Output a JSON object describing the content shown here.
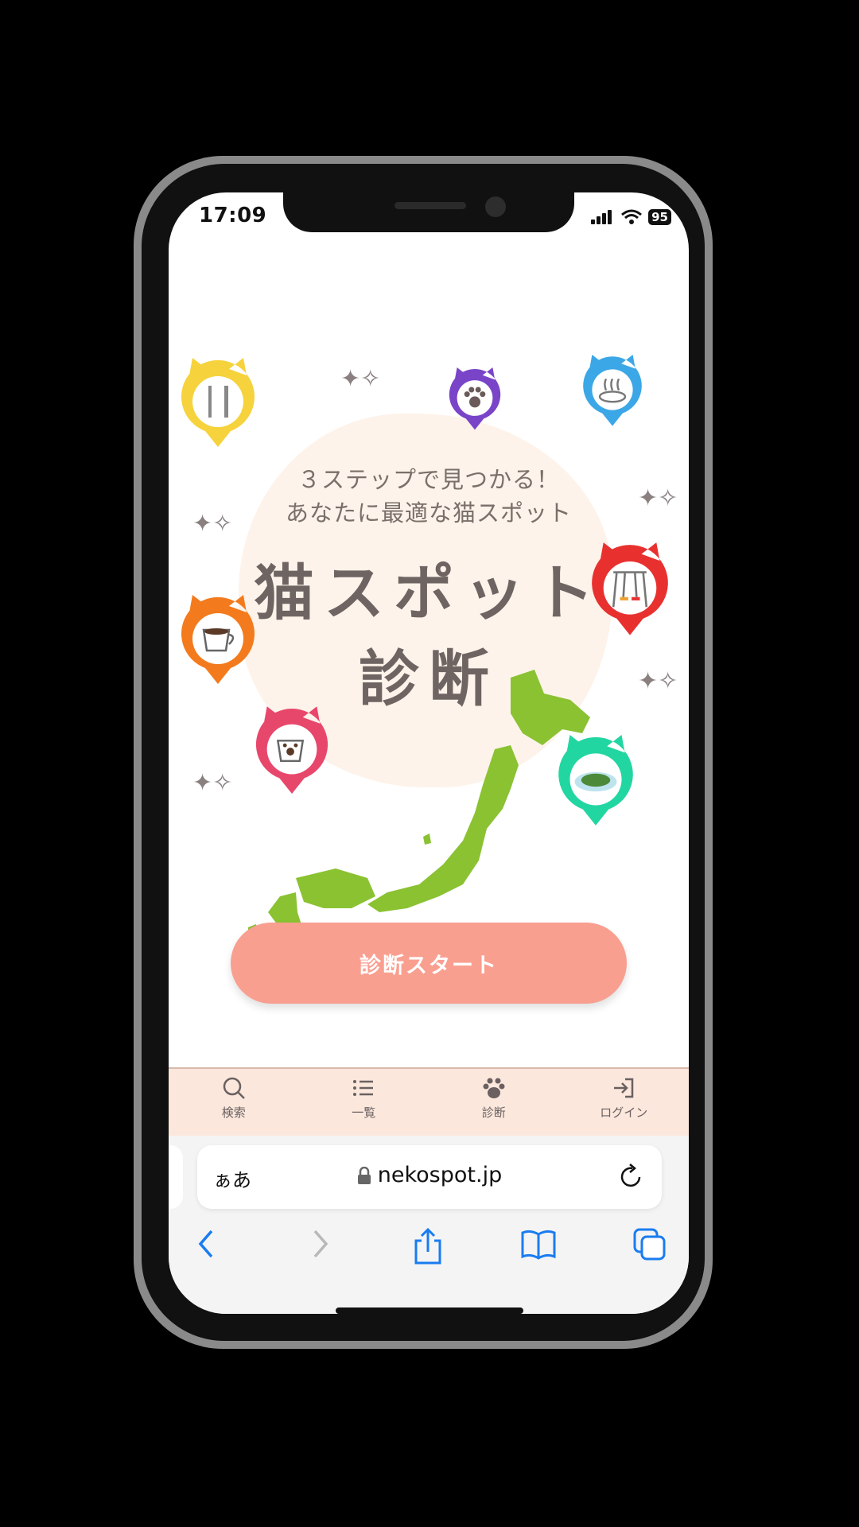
{
  "status_bar": {
    "time": "17:09",
    "battery": "95"
  },
  "hero": {
    "tagline_line1": "３ステップで見つかる！",
    "tagline_line2": "あなたに最適な猫スポット",
    "title_line1": "猫スポット",
    "title_line2": "診断",
    "pins": [
      {
        "name": "restaurant-pin-icon",
        "color": "#f6d23c"
      },
      {
        "name": "paw-pin-icon",
        "color": "#7a44c8"
      },
      {
        "name": "onsen-pin-icon",
        "color": "#3ba7e6"
      },
      {
        "name": "playground-pin-icon",
        "color": "#e8312f"
      },
      {
        "name": "coffee-pin-icon",
        "color": "#f37b1d"
      },
      {
        "name": "cat-cafe-pin-icon",
        "color": "#e8476c"
      },
      {
        "name": "island-pin-icon",
        "color": "#22d6a2"
      }
    ],
    "map_color": "#8ac232"
  },
  "start_button": {
    "label": "診断スタート",
    "color": "#f99f90"
  },
  "tabbar": {
    "items": [
      {
        "label": "検索",
        "icon": "search-icon"
      },
      {
        "label": "一覧",
        "icon": "list-icon"
      },
      {
        "label": "診断",
        "icon": "paw-icon"
      },
      {
        "label": "ログイン",
        "icon": "login-icon"
      }
    ],
    "background": "#fbe7dc"
  },
  "browser": {
    "text_size_button": "ぁあ",
    "url": "nekospot.jp",
    "accent": "#1a7cf0"
  }
}
